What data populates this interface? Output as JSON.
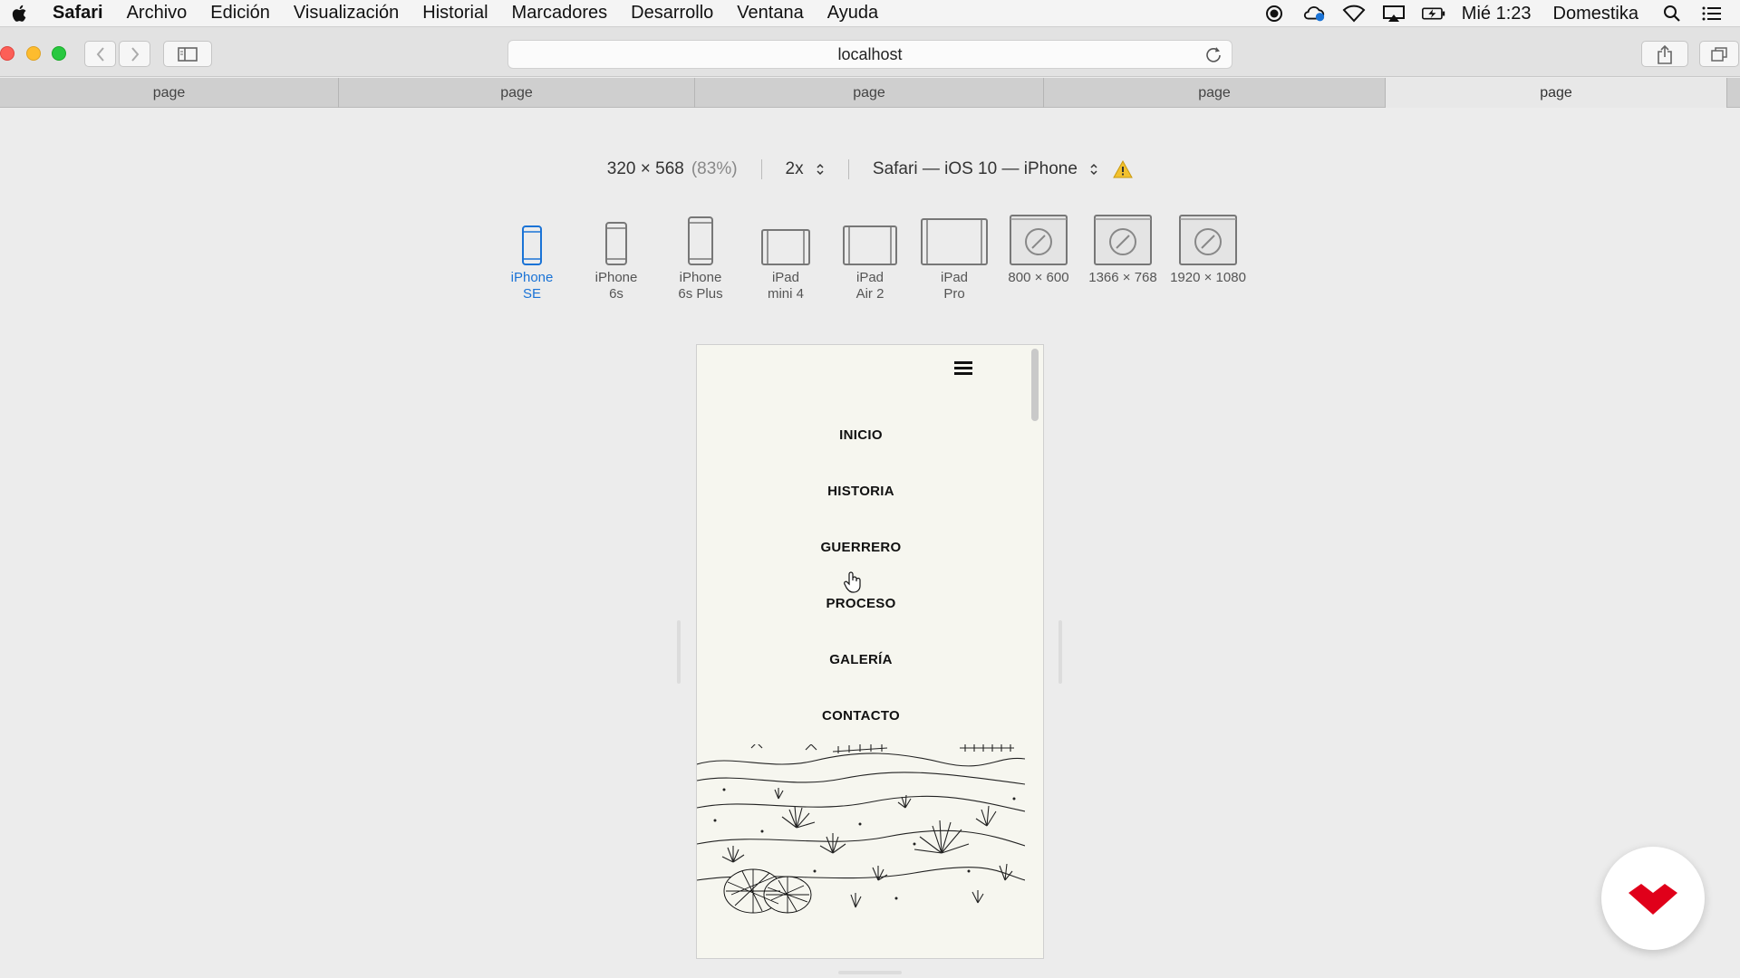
{
  "menubar": {
    "app": "Safari",
    "items": [
      "Archivo",
      "Edición",
      "Visualización",
      "Historial",
      "Marcadores",
      "Desarrollo",
      "Ventana",
      "Ayuda"
    ],
    "clock": "Mié 1:23",
    "user": "Domestika"
  },
  "toolbar": {
    "url": "localhost"
  },
  "tabs": [
    {
      "label": "page"
    },
    {
      "label": "page"
    },
    {
      "label": "page"
    },
    {
      "label": "page"
    },
    {
      "label": "page",
      "active": true
    }
  ],
  "rdm": {
    "size": "320 × 568",
    "zoom": "(83%)",
    "scale": "2x",
    "agent": "Safari — iOS 10 — iPhone"
  },
  "devices": [
    {
      "label": "iPhone\nSE",
      "selected": true
    },
    {
      "label": "iPhone\n6s"
    },
    {
      "label": "iPhone\n6s Plus"
    },
    {
      "label": "iPad\nmini 4"
    },
    {
      "label": "iPad\nAir 2"
    },
    {
      "label": "iPad\nPro"
    },
    {
      "label": "800 × 600"
    },
    {
      "label": "1366 × 768"
    },
    {
      "label": "1920 × 1080"
    }
  ],
  "site": {
    "nav": [
      "INICIO",
      "HISTORIA",
      "GUERRERO",
      "PROCESO",
      "GALERÍA",
      "CONTACTO"
    ]
  },
  "colors": {
    "accent": "#1a73d6",
    "brand": "#e0001a",
    "page_bg": "#f6f6ef"
  }
}
